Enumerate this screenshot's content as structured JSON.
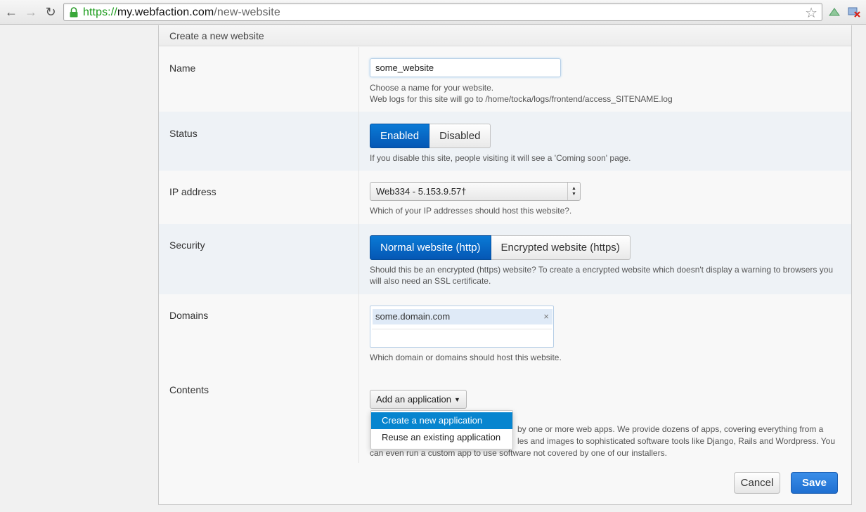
{
  "browser": {
    "url_scheme": "https://",
    "url_host": "my.webfaction.com",
    "url_path": "/new-website",
    "icons": [
      "back-icon",
      "forward-icon",
      "reload-icon",
      "lock-icon",
      "star-icon",
      "extension-icon",
      "extension-icon"
    ]
  },
  "panel": {
    "title": "Create a new website"
  },
  "name_row": {
    "label": "Name",
    "value": "some_website",
    "help_1": "Choose a name for your website.",
    "help_2": "Web logs for this site will go to /home/tocka/logs/frontend/access_SITENAME.log"
  },
  "status_row": {
    "label": "Status",
    "enabled_label": "Enabled",
    "disabled_label": "Disabled",
    "selected": "Enabled",
    "help": "If you disable this site, people visiting it will see a 'Coming soon' page."
  },
  "ip_row": {
    "label": "IP address",
    "selected": "Web334 - 5.153.9.57†",
    "help": "Which of your IP addresses should host this website?."
  },
  "security_row": {
    "label": "Security",
    "http_label": "Normal website (http)",
    "https_label": "Encrypted website (https)",
    "selected": "Normal website (http)",
    "help_1": "Should this be an encrypted (https) website? To create a encrypted website which doesn't display a warning to browsers you",
    "help_2": "will also need an SSL certificate."
  },
  "domains_row": {
    "label": "Domains",
    "tags": [
      "some.domain.com"
    ],
    "remove_symbol": "×",
    "help": "Which domain or domains should host this website."
  },
  "contents_row": {
    "label": "Contents",
    "dropdown_label": "Add an application",
    "menu_items": [
      "Create a new application",
      "Reuse an existing application"
    ],
    "help_1": "by one or more web apps. We provide dozens of apps, covering everything from a",
    "help_2": "les and images to sophisticated software tools like Django, Rails and Wordpress. You",
    "help_3": "can even run a custom app to use software not covered by one of our installers."
  },
  "actions": {
    "cancel_label": "Cancel",
    "save_label": "Save"
  },
  "colors": {
    "accent": "#0557b5",
    "save": "#1f6fd1",
    "url_scheme": "#1a9b1a"
  }
}
